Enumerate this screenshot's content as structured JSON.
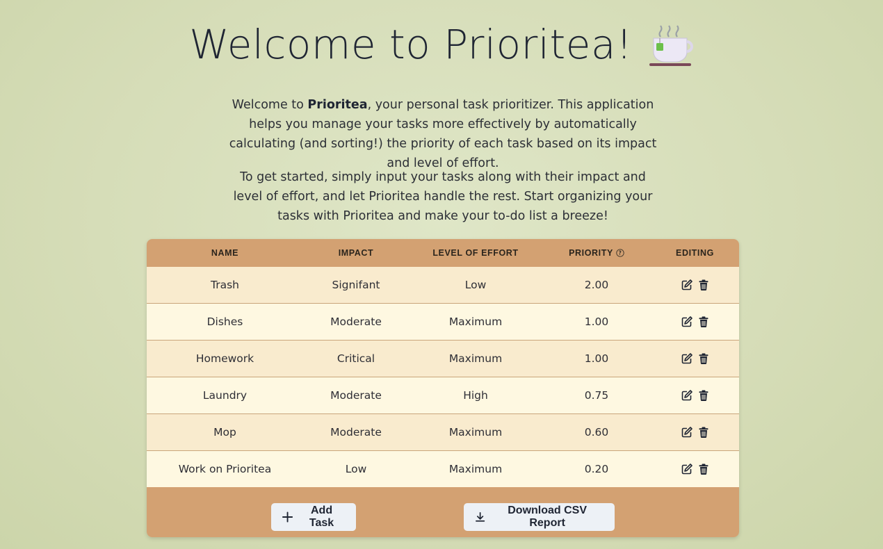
{
  "header": {
    "title": "Welcome to Prioritea!",
    "icon": "teacup-icon"
  },
  "intro": {
    "p1_pre": "Welcome to ",
    "p1_bold": "Prioritea",
    "p1_post": ", your personal task prioritizer. This application helps you manage your tasks more effectively by automatically calculating (and sorting!) the priority of each task based on its impact and level of effort.",
    "p2": "To get started, simply input your tasks along with their impact and level of effort, and let Prioritea handle the rest. Start organizing your tasks with Prioritea and make your to-do list a breeze!"
  },
  "table": {
    "columns": [
      "Name",
      "Impact",
      "Level of Effort",
      "Priority",
      "Editing"
    ],
    "rows": [
      {
        "name": "Trash",
        "impact": "Signifant",
        "effort": "Low",
        "priority": "2.00"
      },
      {
        "name": "Dishes",
        "impact": "Moderate",
        "effort": "Maximum",
        "priority": "1.00"
      },
      {
        "name": "Homework",
        "impact": "Critical",
        "effort": "Maximum",
        "priority": "1.00"
      },
      {
        "name": "Laundry",
        "impact": "Moderate",
        "effort": "High",
        "priority": "0.75"
      },
      {
        "name": "Mop",
        "impact": "Moderate",
        "effort": "Maximum",
        "priority": "0.60"
      },
      {
        "name": "Work on Prioritea",
        "impact": "Low",
        "effort": "Maximum",
        "priority": "0.20"
      }
    ]
  },
  "footer": {
    "add_label": "Add Task",
    "download_label": "Download CSV Report"
  },
  "colors": {
    "background": "#d6ddb8",
    "header": "#d3a172",
    "row_odd": "#f9ebce",
    "row_even": "#fef8e1",
    "button": "#edf1f6"
  }
}
